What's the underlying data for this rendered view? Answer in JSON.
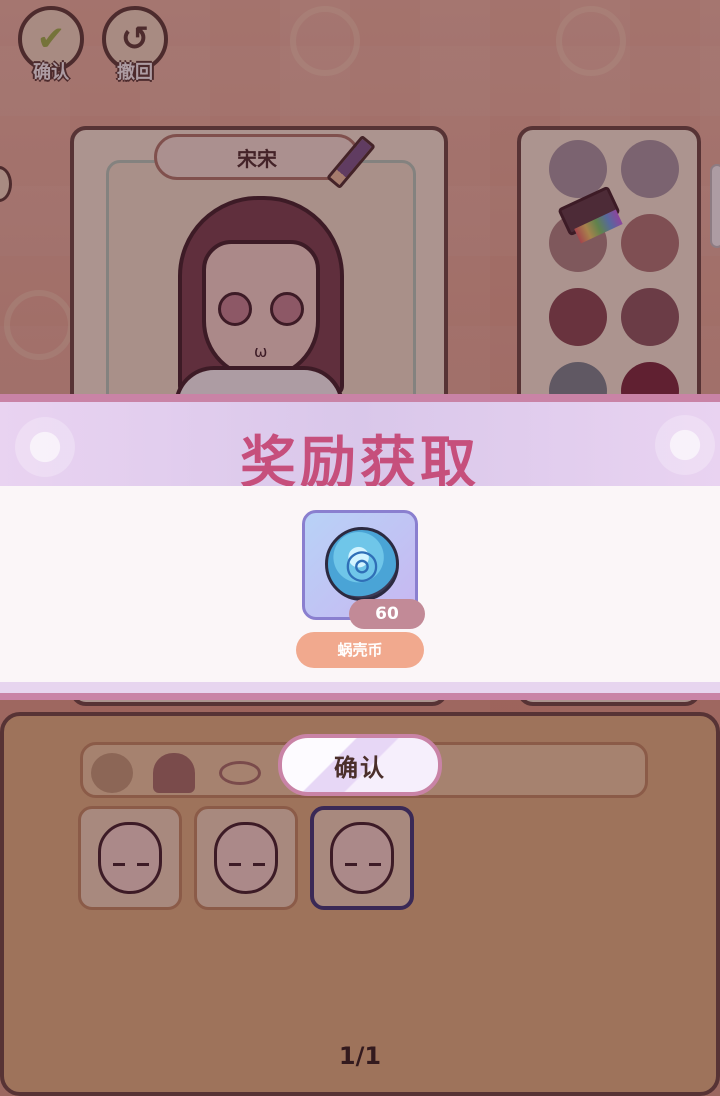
{
  "topbar": {
    "confirm_label": "确认",
    "undo_label": "撤回",
    "confirm_icon": "checkmark-icon",
    "undo_icon": "undo-arrow-icon"
  },
  "character": {
    "name": "宋宋",
    "edit_icon": "pencil-icon"
  },
  "palette": {
    "tool_icon": "paint-brush-icon",
    "swatches": [
      "#a99ea8",
      "#a99ea8",
      "#b08a86",
      "#b07a76",
      "#8a4a52",
      "#8e5a60",
      "#7a8a92",
      "#7a2a3c"
    ]
  },
  "customize": {
    "tabs": [
      "face-tab-icon",
      "hair-tab-icon",
      "eye-tab-icon"
    ],
    "options": [
      "face-option-1",
      "face-option-2",
      "face-option-3"
    ],
    "selected_index": 2,
    "pager": "1/1"
  },
  "reward": {
    "title": "奖励获取",
    "item_name": "蜗壳币",
    "item_count": "60",
    "item_icon": "spiral-coin-icon"
  },
  "dialog": {
    "confirm_label": "确认"
  },
  "colors": {
    "title": "#c64f7c",
    "accent": "#c983a6",
    "item_name_bg": "#f1a98e",
    "count_bg": "#c28a97"
  }
}
